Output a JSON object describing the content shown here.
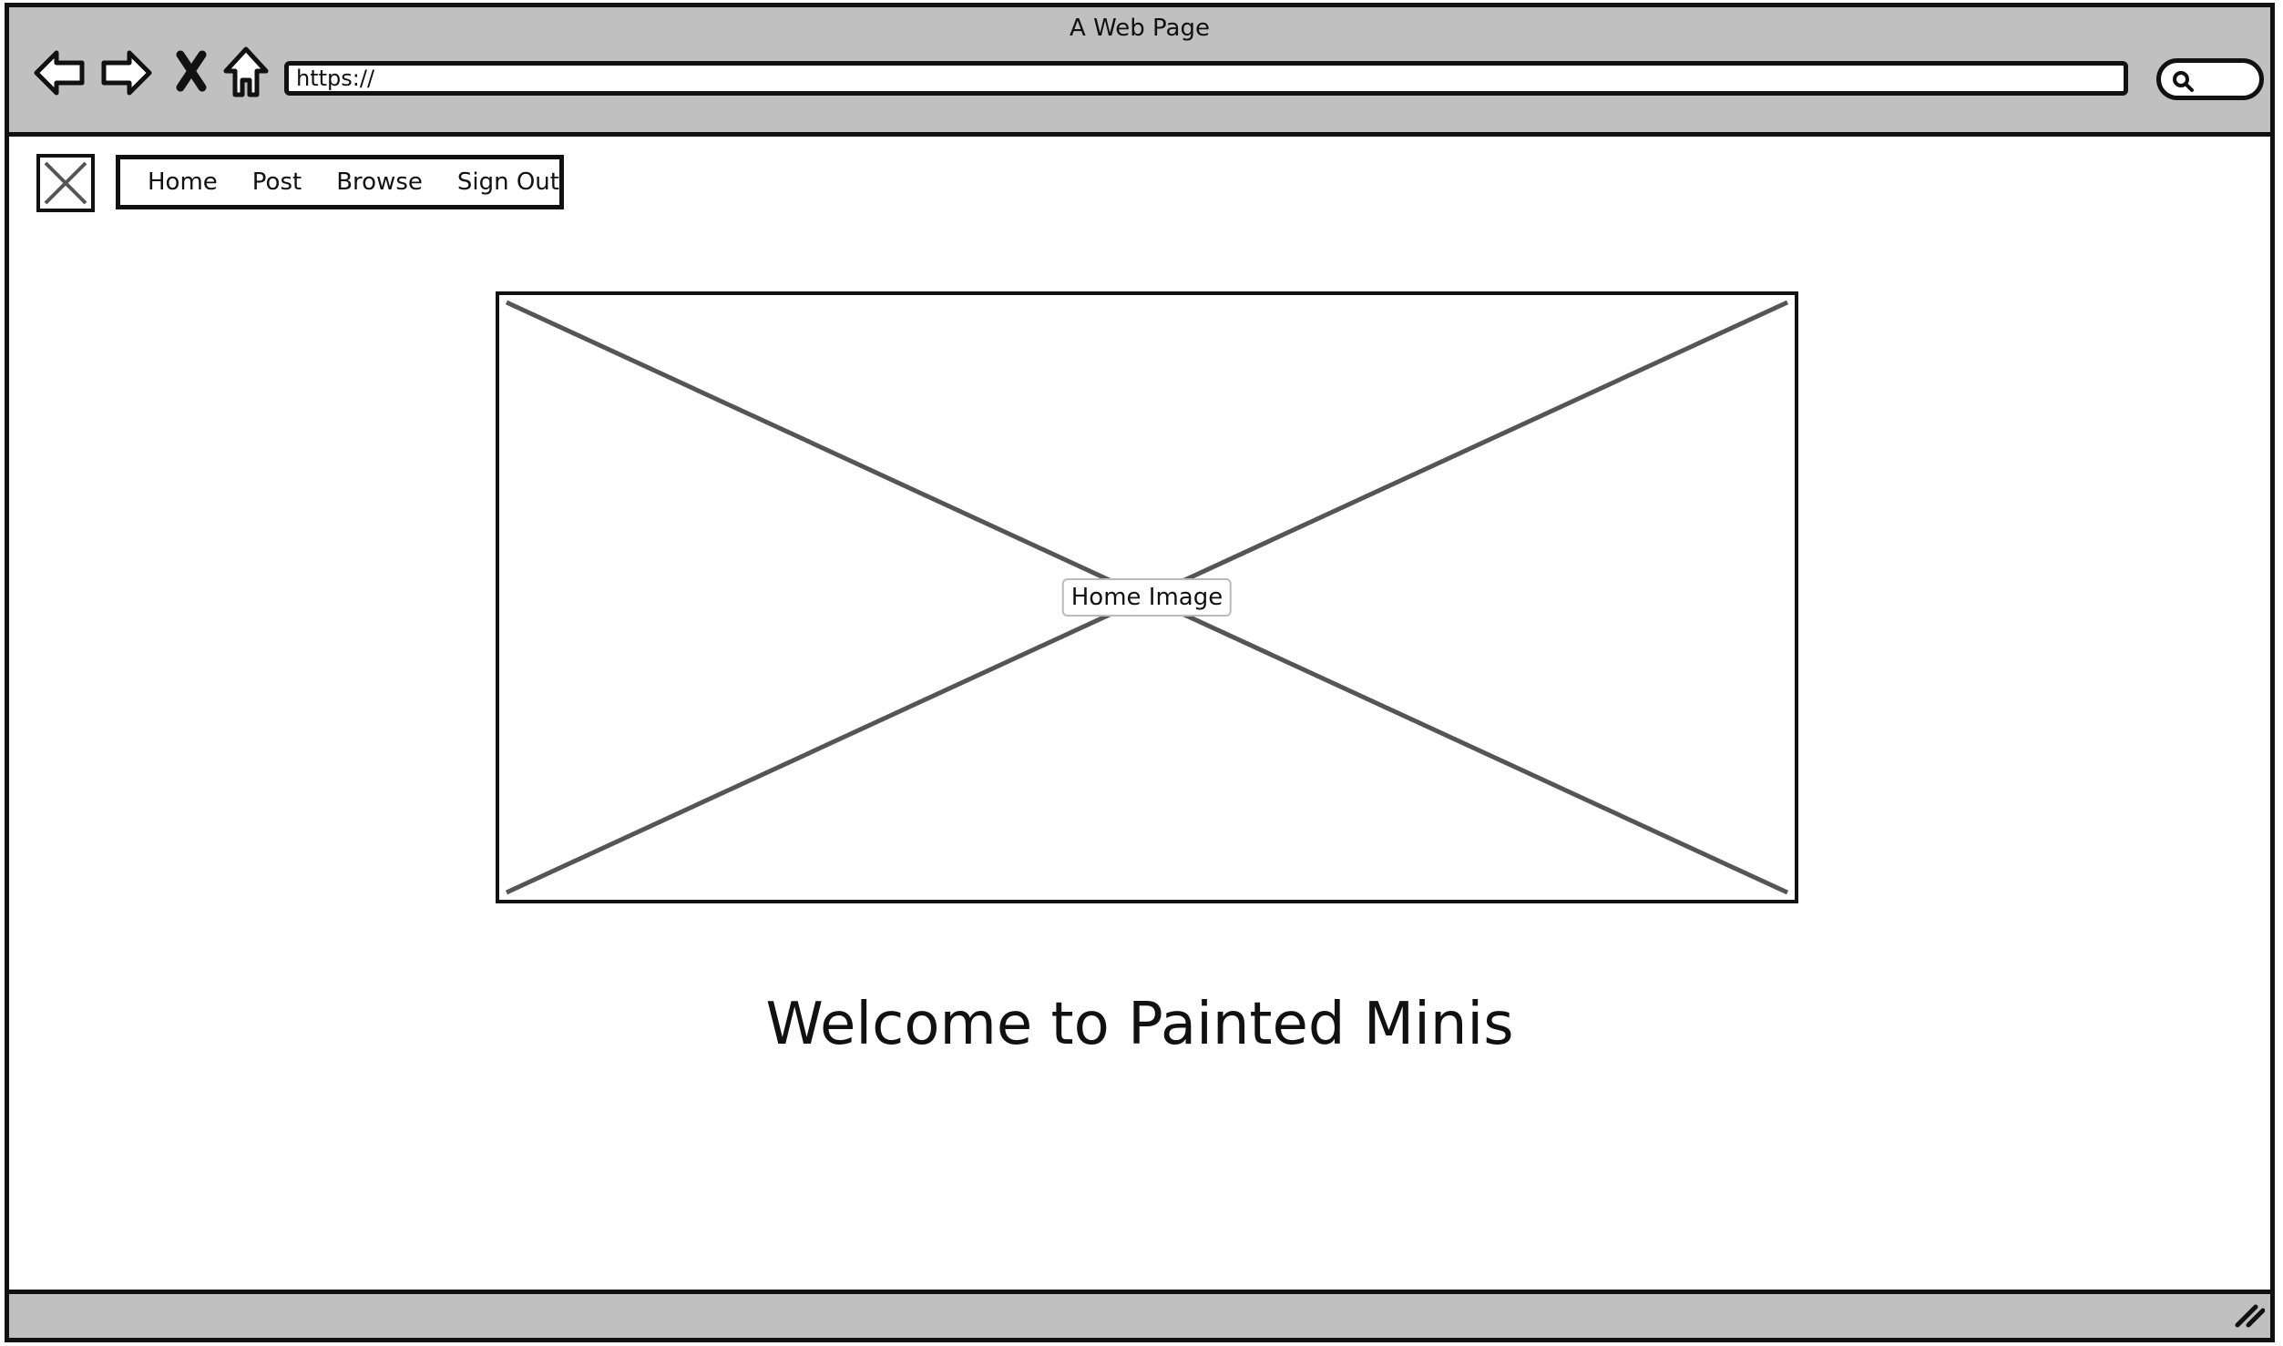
{
  "window": {
    "title": "A Web Page"
  },
  "browser": {
    "address": "https://",
    "icons": [
      "back-arrow-icon",
      "forward-arrow-icon",
      "stop-icon",
      "home-icon",
      "search-icon"
    ]
  },
  "site": {
    "logo_icon": "image-placeholder-icon",
    "menu": [
      {
        "label": "Home"
      },
      {
        "label": "Post"
      },
      {
        "label": "Browse"
      },
      {
        "label": "Sign Out"
      }
    ],
    "hero_image_label": "Home Image",
    "heading": "Welcome to Painted Minis"
  },
  "colors": {
    "chrome_gray": "#c0c0c0",
    "line": "#111111",
    "placeholder_line": "#555555"
  }
}
